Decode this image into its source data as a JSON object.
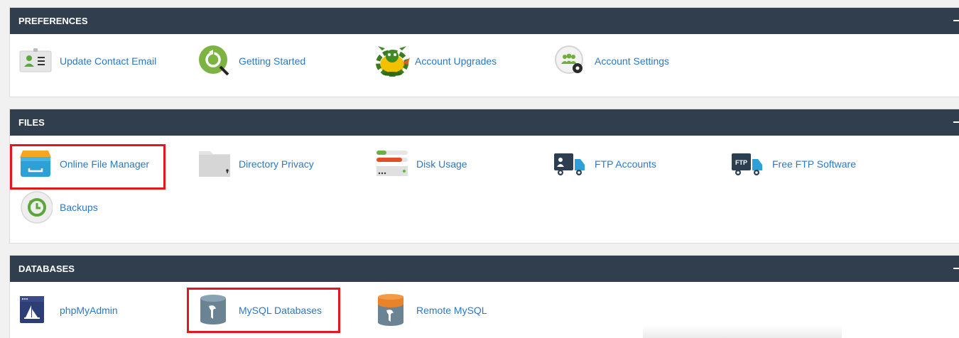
{
  "sections": {
    "preferences": {
      "title": "PREFERENCES",
      "items": [
        {
          "label": "Update Contact Email",
          "icon": "contact-card-icon"
        },
        {
          "label": "Getting Started",
          "icon": "getting-started-icon"
        },
        {
          "label": "Account Upgrades",
          "icon": "dragon-icon"
        },
        {
          "label": "Account Settings",
          "icon": "account-settings-icon"
        }
      ]
    },
    "files": {
      "title": "FILES",
      "items": [
        {
          "label": "Online File Manager",
          "icon": "file-manager-icon"
        },
        {
          "label": "Directory Privacy",
          "icon": "directory-privacy-icon"
        },
        {
          "label": "Disk Usage",
          "icon": "disk-usage-icon"
        },
        {
          "label": "FTP Accounts",
          "icon": "ftp-accounts-icon"
        },
        {
          "label": "Free FTP Software",
          "icon": "ftp-truck-icon"
        },
        {
          "label": "Backups",
          "icon": "backups-icon"
        }
      ]
    },
    "databases": {
      "title": "DATABASES",
      "items": [
        {
          "label": "phpMyAdmin",
          "icon": "phpmyadmin-icon"
        },
        {
          "label": "MySQL Databases",
          "icon": "mysql-database-icon"
        },
        {
          "label": "Remote MySQL",
          "icon": "remote-mysql-icon"
        }
      ]
    }
  },
  "ftp_badge_text": "FTP",
  "colors": {
    "header_bg": "#313e4d",
    "link": "#2b78c5",
    "highlight": "#e3171d"
  }
}
